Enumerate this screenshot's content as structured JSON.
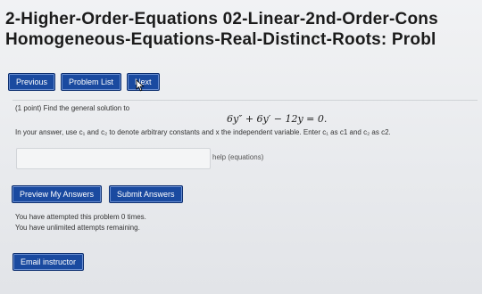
{
  "header": {
    "title_line1": "2-Higher-Order-Equations 02-Linear-2nd-Order-Cons",
    "title_line2": "Homogeneous-Equations-Real-Distinct-Roots: Probl"
  },
  "nav": {
    "previous": "Previous",
    "problem_list": "Problem List",
    "next": "Next"
  },
  "problem": {
    "intro": "(1 point) Find the general solution to",
    "equation": "6y″ + 6y′ − 12y = 0.",
    "instructions": "In your answer, use c₁ and c₂ to denote arbitrary constants and x the independent variable. Enter c₁ as c1 and c₂ as c2.",
    "answer_value": "",
    "help_link": "help (equations)"
  },
  "actions": {
    "preview": "Preview My Answers",
    "submit": "Submit Answers"
  },
  "status": {
    "attempted": "You have attempted this problem 0 times.",
    "remaining": "You have unlimited attempts remaining."
  },
  "footer": {
    "email": "Email instructor"
  },
  "colors": {
    "button_bg": "#1a4aa0",
    "button_text": "#ffffff",
    "page_bg": "#e9ebee"
  }
}
